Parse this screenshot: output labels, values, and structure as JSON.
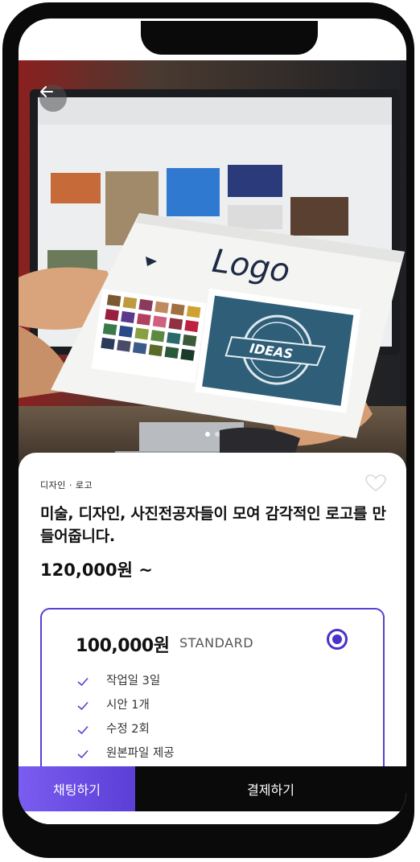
{
  "nav": {
    "back_icon": "arrow-left-icon"
  },
  "hero": {
    "logo_text": "Logo",
    "badge_text": "IDEAS",
    "active_slide": 1,
    "slide_count": 2
  },
  "product": {
    "category": "디자인 · 로고",
    "title": "미술, 디자인, 사진전공자들이 모여 감각적인 로고를 만들어줍니다.",
    "price": "120,000원 ~",
    "favorite_icon": "heart-outline-icon"
  },
  "option": {
    "price": "100,000원",
    "tier": "STANDARD",
    "selected": true,
    "features": [
      "작업일 3일",
      "시안 1개",
      "수정 2회",
      "원본파일 제공"
    ]
  },
  "actions": {
    "chat_label": "채팅하기",
    "pay_label": "결제하기"
  },
  "colors": {
    "accent": "#5b3fd6",
    "dark": "#0a0a0a"
  }
}
